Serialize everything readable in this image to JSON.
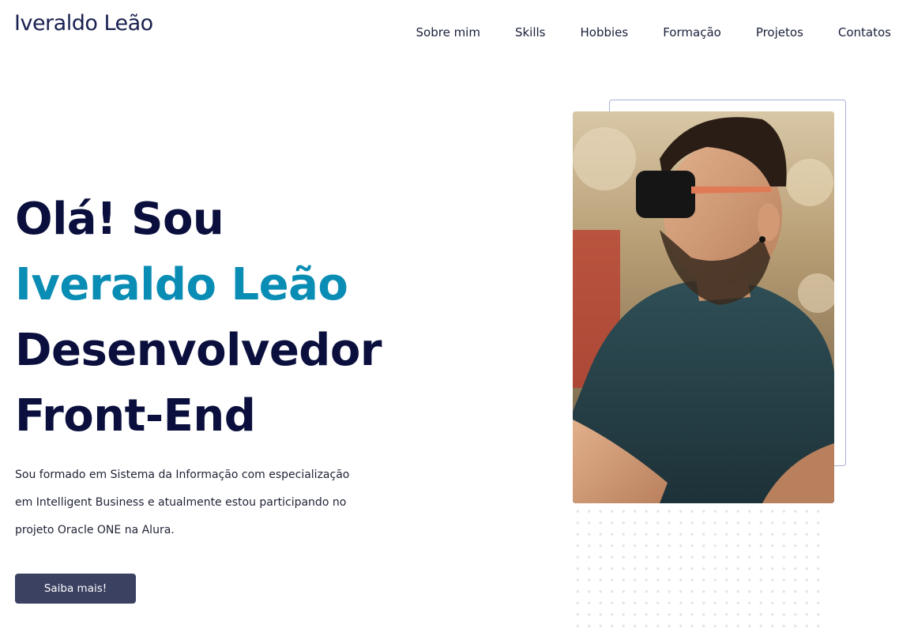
{
  "header": {
    "logo": "Iveraldo Leão",
    "nav": [
      "Sobre mim",
      "Skills",
      "Hobbies",
      "Formação",
      "Projetos",
      "Contatos"
    ]
  },
  "hero": {
    "line1": "Olá! Sou",
    "name": "Iveraldo Leão",
    "line3": "Desenvolvedor",
    "line4": "Front-End",
    "bio": [
      "Sou formado em Sistema da Informação com especialização",
      "em Intelligent Business e atualmente estou participando no",
      "projeto Oracle ONE na Alura."
    ],
    "cta_label": "Saiba mais!"
  },
  "colors": {
    "heading": "#0a0f3d",
    "accent": "#0a8db4",
    "button": "#3b4161"
  }
}
